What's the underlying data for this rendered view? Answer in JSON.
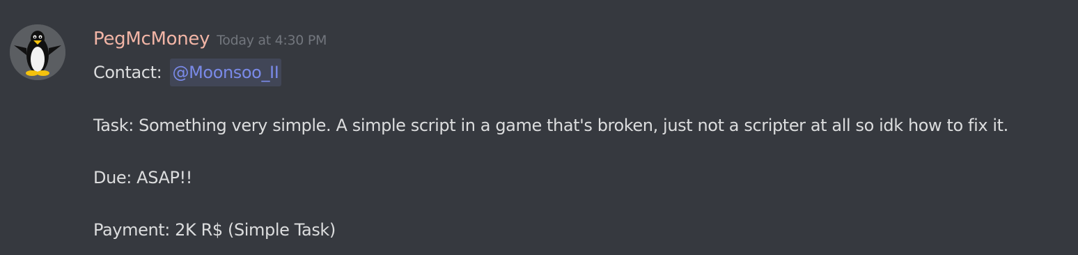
{
  "message": {
    "author": "PegMcMoney",
    "timestamp": "Today at 4:30 PM",
    "contact_label": "Contact:",
    "contact_mention": "@Moonsoo_II",
    "task": "Task: Something very simple. A simple script in a game that's broken, just not a scripter at all so idk how to fix it.",
    "due": "Due: ASAP!!",
    "payment": "Payment: 2K R$ (Simple Task)"
  },
  "colors": {
    "background": "#36393f",
    "author": "#f2b5a6",
    "timestamp": "#72767d",
    "text": "#dcddde",
    "mention_text": "#7a8ae8",
    "mention_bg": "#414657"
  },
  "avatar": {
    "icon": "penguin-icon"
  }
}
